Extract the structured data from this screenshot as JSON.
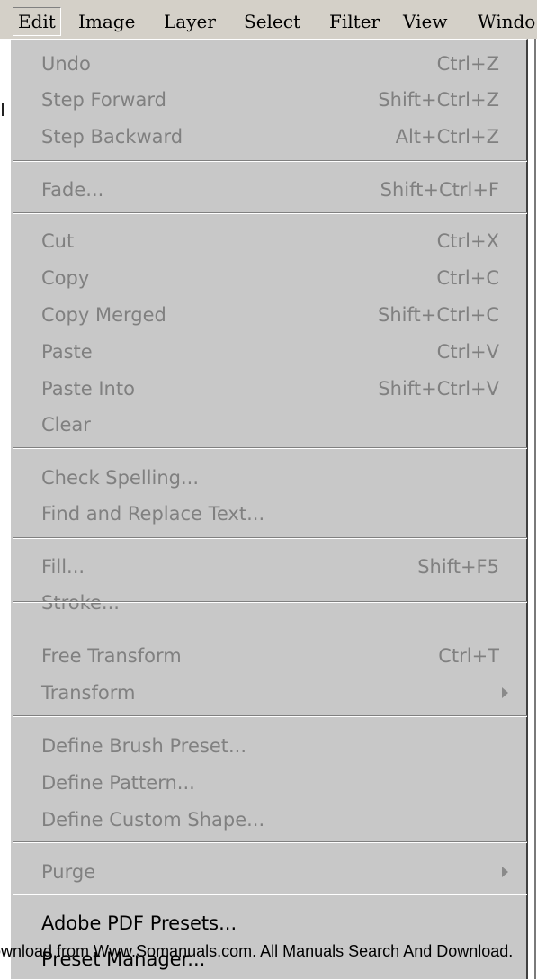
{
  "menubar": {
    "items": [
      "Edit",
      "Image",
      "Layer",
      "Select",
      "Filter",
      "View",
      "Windo"
    ]
  },
  "edit_menu": {
    "undo": {
      "label": "Undo",
      "shortcut": "Ctrl+Z"
    },
    "step_forward": {
      "label": "Step Forward",
      "shortcut": "Shift+Ctrl+Z"
    },
    "step_backward": {
      "label": "Step Backward",
      "shortcut": "Alt+Ctrl+Z"
    },
    "fade": {
      "label": "Fade...",
      "shortcut": "Shift+Ctrl+F"
    },
    "cut": {
      "label": "Cut",
      "shortcut": "Ctrl+X"
    },
    "copy": {
      "label": "Copy",
      "shortcut": "Ctrl+C"
    },
    "copy_merged": {
      "label": "Copy Merged",
      "shortcut": "Shift+Ctrl+C"
    },
    "paste": {
      "label": "Paste",
      "shortcut": "Ctrl+V"
    },
    "paste_into": {
      "label": "Paste Into",
      "shortcut": "Shift+Ctrl+V"
    },
    "clear": {
      "label": "Clear"
    },
    "check_spelling": {
      "label": "Check Spelling..."
    },
    "find_replace": {
      "label": "Find and Replace Text..."
    },
    "fill": {
      "label": "Fill...",
      "shortcut": "Shift+F5"
    },
    "stroke": {
      "label": "Stroke..."
    },
    "free_transform": {
      "label": "Free Transform",
      "shortcut": "Ctrl+T"
    },
    "transform": {
      "label": "Transform"
    },
    "define_brush": {
      "label": "Define Brush Preset..."
    },
    "define_pattern": {
      "label": "Define Pattern..."
    },
    "define_shape": {
      "label": "Define Custom Shape..."
    },
    "purge": {
      "label": "Purge"
    },
    "adobe_pdf": {
      "label": "Adobe PDF Presets..."
    },
    "preset_manager": {
      "label": "Preset Manager..."
    }
  },
  "colors": {
    "menu_bg": "#c8c8c8",
    "disabled_text": "#808080",
    "enabled_text": "#000000"
  },
  "watermark": "Download from Www.Somanuals.com. All Manuals Search And Download."
}
